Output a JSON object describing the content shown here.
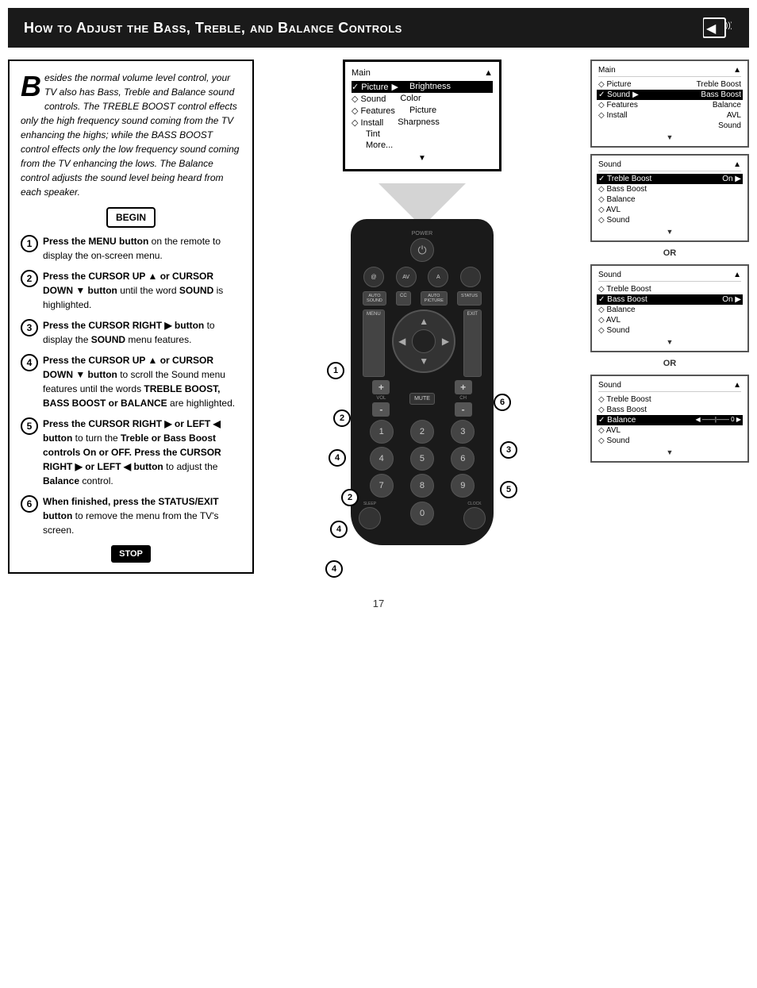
{
  "header": {
    "title": "How to Adjust the Bass, Treble, and Balance Controls",
    "icon": "🔊"
  },
  "intro": {
    "big_letter": "B",
    "text": "esides the normal volume level control, your TV also has Bass, Treble and Balance sound controls. The TREBLE BOOST control effects only the high frequency sound coming from the TV enhancing the highs; while the BASS BOOST control effects only the low frequency sound coming from the TV enhancing the lows. The Balance control adjusts the sound level being heard from each speaker."
  },
  "begin_label": "BEGIN",
  "stop_label": "STOP",
  "steps": [
    {
      "num": "1",
      "text": "Press the MENU button on the remote to display the on-screen menu."
    },
    {
      "num": "2",
      "text": "Press the CURSOR UP ▲ or CURSOR DOWN ▼ button until the word SOUND is highlighted."
    },
    {
      "num": "3",
      "text": "Press the CURSOR RIGHT ▶ button to display the SOUND menu features."
    },
    {
      "num": "4",
      "text": "Press the CURSOR UP ▲ or CURSOR DOWN ▼ button to scroll the Sound menu features until the words TREBLE BOOST, BASS BOOST or BALANCE are highlighted."
    },
    {
      "num": "5",
      "text": "Press the CURSOR RIGHT ▶ or LEFT ◀ button to turn the Treble or Bass Boost controls On or OFF. Press the CURSOR RIGHT ▶ or LEFT ◀ button to adjust the Balance control."
    },
    {
      "num": "6",
      "text": "When finished, press the STATUS/EXIT button to remove the menu from the TV's screen."
    }
  ],
  "main_menu": {
    "header_left": "Main",
    "header_right": "▲",
    "rows": [
      {
        "label": "✓ Picture",
        "arrow": "▶",
        "submenu": "Brightness"
      },
      {
        "label": "◇ Sound",
        "submenu": "Color"
      },
      {
        "label": "◇ Features",
        "submenu": "Picture"
      },
      {
        "label": "◇ Install",
        "submenu": "Sharpness"
      },
      {
        "submenu": "Tint"
      },
      {
        "submenu": "More..."
      }
    ],
    "arrow_down": "▼"
  },
  "sound_menu_1": {
    "header_left": "Main",
    "header_right": "▲",
    "rows": [
      {
        "label": "◇ Picture",
        "value": "Treble Boost"
      },
      {
        "label": "✓ Sound",
        "arrow": "▶",
        "value": "Bass Boost",
        "selected": true
      },
      {
        "label": "◇ Features",
        "value": "Balance"
      },
      {
        "label": "◇ Install",
        "value": "AVL"
      },
      {
        "value": "Sound"
      }
    ],
    "arrow_down": "▼"
  },
  "sound_menu_2": {
    "header_left": "Sound",
    "header_right": "▲",
    "rows": [
      {
        "label": "✓ Treble Boost",
        "value": "On ▶",
        "selected": true
      },
      {
        "label": "◇ Bass Boost"
      },
      {
        "label": "◇ Balance"
      },
      {
        "label": "◇ AVL"
      },
      {
        "label": "◇ Sound"
      }
    ],
    "arrow_down": "▼"
  },
  "sound_menu_3": {
    "header_left": "Sound",
    "header_right": "▲",
    "rows": [
      {
        "label": "◇ Treble Boost"
      },
      {
        "label": "✓ Bass Boost",
        "value": "On ▶",
        "selected": true
      },
      {
        "label": "◇ Balance"
      },
      {
        "label": "◇ AVL"
      },
      {
        "label": "◇ Sound"
      }
    ],
    "arrow_down": "▼"
  },
  "sound_menu_4": {
    "header_left": "Sound",
    "header_right": "▲",
    "rows": [
      {
        "label": "◇ Treble Boost"
      },
      {
        "label": "◇ Bass Boost"
      },
      {
        "label": "✓ Balance",
        "value": "◀ ——————|—— 0 ▶",
        "selected": true
      },
      {
        "label": "◇ AVL"
      },
      {
        "label": "◇ Sound"
      }
    ],
    "arrow_down": "▼"
  },
  "or_text": "OR",
  "page_number": "17",
  "remote": {
    "power_label": "POWER",
    "buttons": {
      "top_row": [
        "@",
        "AV",
        "A"
      ],
      "icon_row": [
        "AUTO\nSOUND",
        "CC",
        "AUTO\nPICTURE",
        "STATUS"
      ],
      "nav_labels": [
        "MENU",
        "EXIT"
      ],
      "middle_labels": [
        "VOL",
        "CH",
        "MUTE"
      ],
      "numpad": [
        "1",
        "2",
        "3",
        "4",
        "5",
        "6",
        "7",
        "8",
        "9",
        "SLEEP",
        "0",
        "CLOCK"
      ]
    }
  }
}
